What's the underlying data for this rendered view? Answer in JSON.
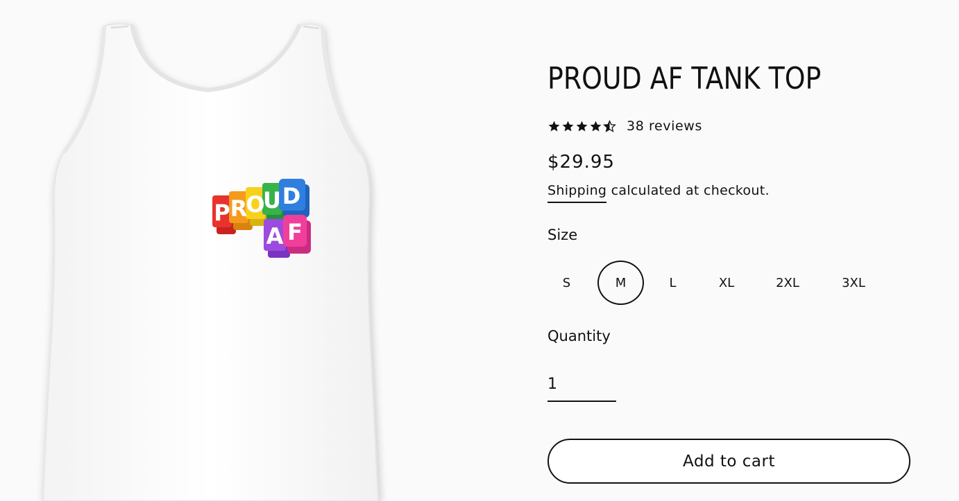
{
  "product": {
    "title": "PROUD AF TANK TOP",
    "image_alt": "Tank top product photo",
    "print_text": [
      "PROUD",
      "AF"
    ],
    "rating": {
      "value": 4.5,
      "max": 5,
      "reviews_label": "38 reviews"
    },
    "price": "$29.95",
    "shipping": {
      "link_label": "Shipping",
      "suffix": " calculated at checkout."
    },
    "size": {
      "label": "Size",
      "options": [
        "S",
        "M",
        "L",
        "XL",
        "2XL",
        "3XL"
      ],
      "selected": "M"
    },
    "quantity": {
      "label": "Quantity",
      "value": "1"
    },
    "add_to_cart_label": "Add to cart"
  },
  "colors": {
    "background": "#fafafa",
    "text": "#111111",
    "print_rainbow": [
      "#e8332c",
      "#f59a1c",
      "#f7d21d",
      "#37b34a",
      "#2f7fe0",
      "#9b4be0",
      "#ef3f9b"
    ]
  },
  "icons": {
    "star": "star-icon",
    "half_star": "half-star-icon"
  }
}
